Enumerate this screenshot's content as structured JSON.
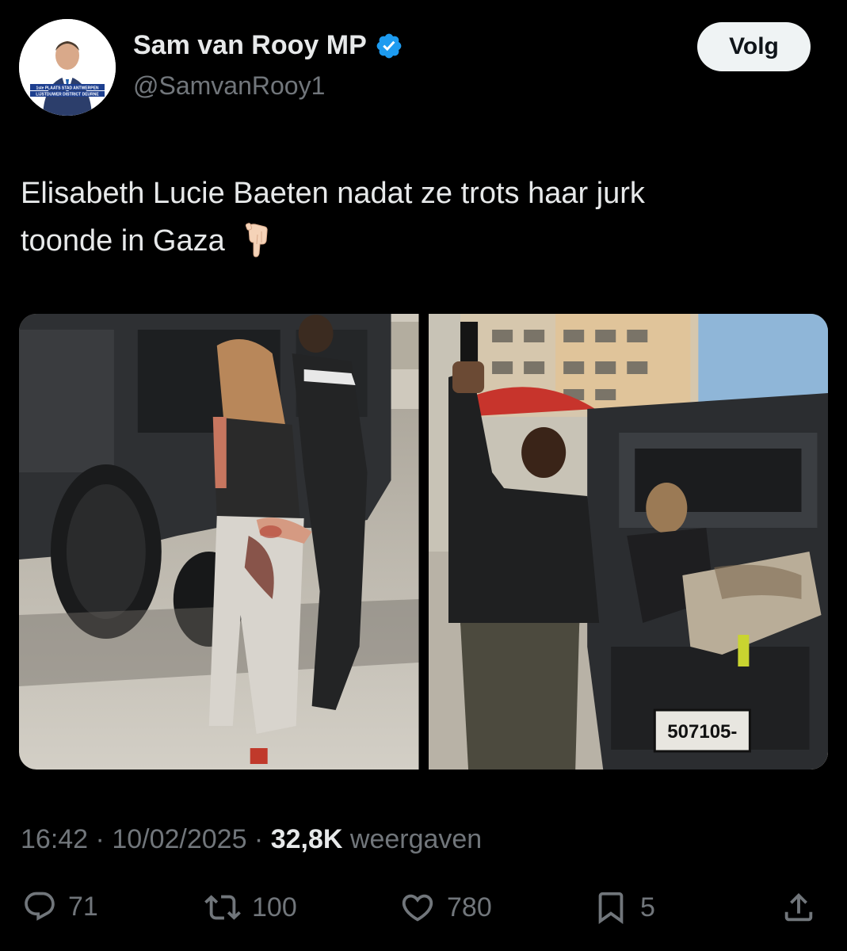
{
  "author": {
    "display_name": "Sam van Rooy MP",
    "handle": "@SamvanRooy1",
    "avatar_banner_line1": "1ste PLAATS STAD ANTWERPEN",
    "avatar_banner_line2": "LIJSTDUWER DISTRICT DEURNE",
    "verified": true
  },
  "follow_button": {
    "label": "Volg"
  },
  "tweet": {
    "text_line1": "Elisabeth Lucie Baeten nadat ze trots haar jurk",
    "text_line2": "toonde in Gaza",
    "emoji": "backhand-index-pointing-down"
  },
  "media": [
    {
      "name": "photo-woman-handcuffed-by-jeep"
    },
    {
      "name": "photo-woman-seated-in-jeep",
      "plate_text": "507105-"
    }
  ],
  "meta": {
    "time": "16:42",
    "separator": " · ",
    "date": "10/02/2025",
    "views_count": "32,8K",
    "views_label": " weergaven"
  },
  "actions": {
    "replies": "71",
    "reposts": "100",
    "likes": "780",
    "bookmarks": "5"
  },
  "colors": {
    "background": "#000000",
    "text_primary": "#e7e9ea",
    "text_secondary": "#71767b",
    "verified_blue": "#1d9bf0",
    "follow_bg": "#eff3f4"
  }
}
